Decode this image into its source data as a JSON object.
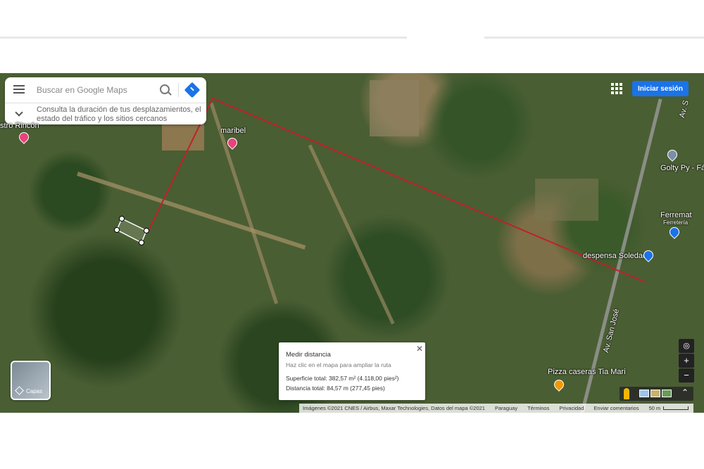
{
  "search": {
    "placeholder": "Buscar en Google Maps",
    "hint": "Consulta la duración de tus desplazamientos, el estado del tráfico y los sitios cercanos"
  },
  "header": {
    "signin_label": "Iniciar sesión"
  },
  "map_labels": {
    "maribel": "maribel",
    "despensa": "despensa Soledad",
    "pizza": "Pizza caseras Tia Mari",
    "golty": "Golty Py - Fáb",
    "ferremat": "Ferremat",
    "ferreteria": "Ferretería",
    "street": "Av. San José",
    "street_top": "Av. S",
    "rincon": "stro Rincón"
  },
  "measure": {
    "title": "Medir distancia",
    "subtitle": "Haz clic en el mapa para ampliar la ruta",
    "area": "Superficie total: 382,57 m² (4.118,00 pies²)",
    "distance": "Distancia total: 84,57 m (277,45 pies)"
  },
  "layers": {
    "label": "Capas"
  },
  "controls": {
    "zoom_in": "+",
    "zoom_out": "−",
    "expand": "⌃"
  },
  "footer": {
    "imagery": "Imágenes ©2021 CNES / Airbus, Maxar Technologies, Datos del mapa ©2021",
    "country": "Paraguay",
    "terms": "Términos",
    "privacy": "Privacidad",
    "feedback": "Enviar comentarios",
    "scale": "50 m"
  },
  "colors": {
    "route": "#c0202a",
    "accent": "#1a73e8"
  }
}
